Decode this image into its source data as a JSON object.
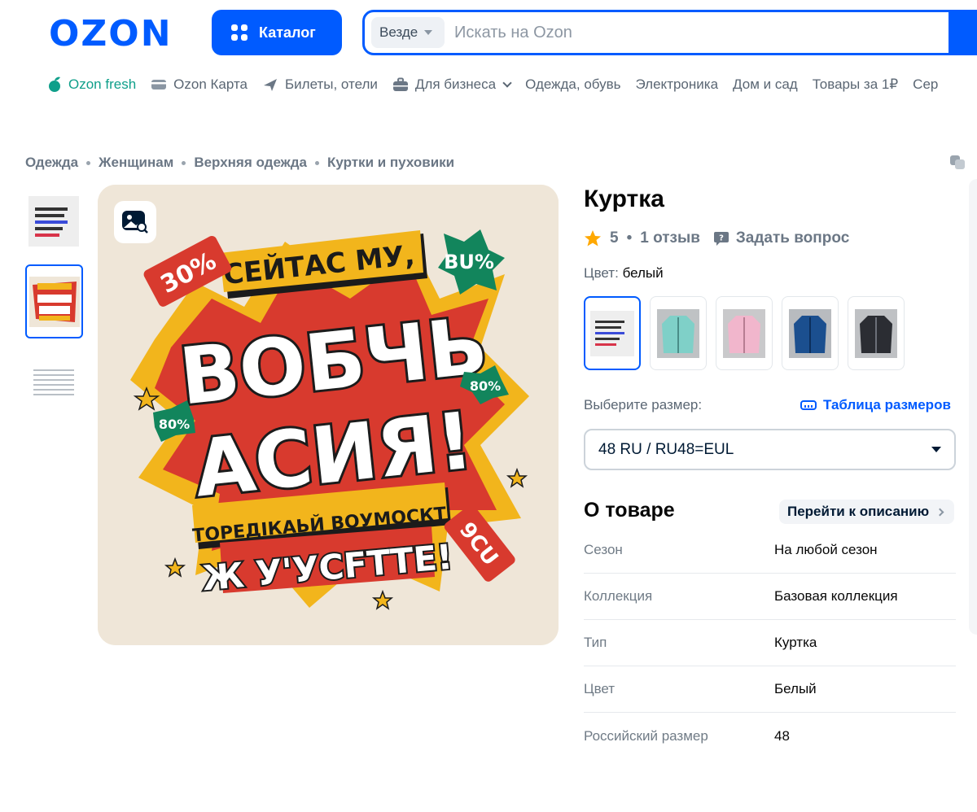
{
  "header": {
    "logo_text": "OZON",
    "catalog_label": "Каталог",
    "search_scope": "Везде",
    "search_placeholder": "Искать на Ozon"
  },
  "nav": {
    "items": [
      {
        "label": "Ozon fresh",
        "icon": "ozon-fresh-icon"
      },
      {
        "label": "Ozon Карта",
        "icon": "card-icon"
      },
      {
        "label": "Билеты, отели",
        "icon": "plane-icon"
      },
      {
        "label": "Для бизнеса",
        "icon": "briefcase-icon"
      },
      {
        "label": "Одежда, обувь"
      },
      {
        "label": "Электроника"
      },
      {
        "label": "Дом и сад"
      },
      {
        "label": "Товары за 1₽"
      },
      {
        "label": "Сер"
      }
    ]
  },
  "breadcrumb": [
    "Одежда",
    "Женщинам",
    "Верхняя одежда",
    "Куртки и пуховики"
  ],
  "gallery": {
    "thumbs": [
      {
        "icon": "poster-text-thumb"
      },
      {
        "icon": "promo-poster-thumb"
      },
      {
        "icon": "size-table-thumb"
      }
    ],
    "main_image": {
      "lines": [
        "СЕЙТАС МУ,",
        "ВОБЧЬ",
        "АСИЯ!",
        "ТОРЕДIКАЬЙ ВОУМОСКТ",
        "Ж У'УСFТТЕ!"
      ],
      "badges": [
        "30%",
        "BU%",
        "80%",
        "80%",
        "9CU"
      ]
    }
  },
  "product": {
    "title": "Куртка",
    "rating": "5",
    "reviews": "1 отзыв",
    "ask_question": "Задать вопрос",
    "color_prefix": "Цвет:",
    "color_value": "белый",
    "size_label": "Выберите размер:",
    "size_table_label": "Таблица размеров",
    "selected_size": "48 RU / RU48=EUL"
  },
  "about": {
    "title": "О товаре",
    "goto_label": "Перейти к описанию",
    "specs": [
      {
        "key": "Сезон",
        "value": "На любой сезон"
      },
      {
        "key": "Коллекция",
        "value": "Базовая коллекция"
      },
      {
        "key": "Тип",
        "value": "Куртка"
      },
      {
        "key": "Цвет",
        "value": "Белый"
      },
      {
        "key": "Российский размер",
        "value": "48"
      }
    ]
  },
  "colors": {
    "brand": "#005bff",
    "fresh": "#0f9f8a",
    "star": "#ffa800"
  }
}
